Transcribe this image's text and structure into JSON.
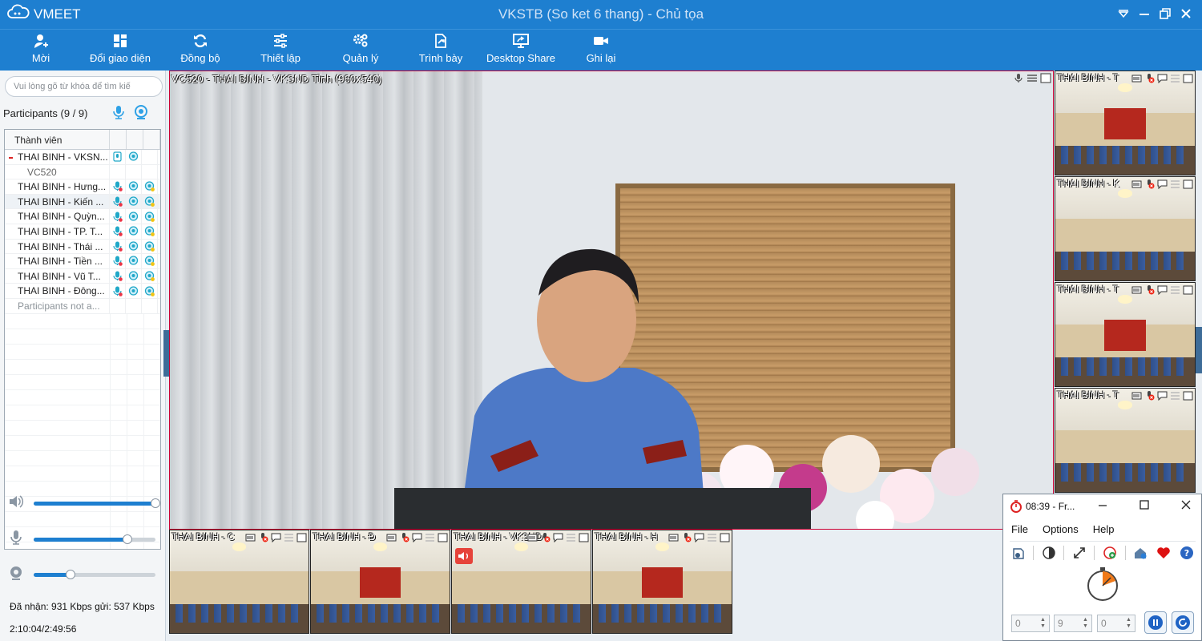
{
  "app": {
    "brand": "VMEET",
    "window_title": "VKSTB (So ket 6 thang) - Chủ tọa"
  },
  "toolbar": [
    {
      "label": "Mời",
      "icon": "invite-user-icon"
    },
    {
      "label": "Đổi giao diện",
      "icon": "layout-icon"
    },
    {
      "label": "Đồng bộ",
      "icon": "sync-icon"
    },
    {
      "label": "Thiết lập",
      "icon": "settings-sliders-icon"
    },
    {
      "label": "Quản lý",
      "icon": "manage-gears-icon"
    },
    {
      "label": "Trình bày",
      "icon": "present-icon"
    },
    {
      "label": "Desktop Share",
      "icon": "desktop-share-icon"
    },
    {
      "label": "Ghi lại",
      "icon": "record-camera-icon"
    }
  ],
  "sidebar": {
    "search_placeholder": "Vui lòng gõ từ khóa để tìm kiế",
    "participants_label": "Participants (9 / 9)",
    "column_header": "Thành viên",
    "participants": [
      {
        "name": "THAI BINH - VKSN...",
        "kind": "host"
      },
      {
        "name": "VC520",
        "kind": "sub"
      },
      {
        "name": "THAI BINH - Hưng...",
        "kind": "normal"
      },
      {
        "name": "THAI BINH - Kiến ...",
        "kind": "selected"
      },
      {
        "name": "THAI BINH - Quỳn...",
        "kind": "normal"
      },
      {
        "name": "THAI BINH - TP. T...",
        "kind": "normal"
      },
      {
        "name": "THAI BINH - Thái ...",
        "kind": "normal"
      },
      {
        "name": "THAI BINH - Tiền ...",
        "kind": "normal"
      },
      {
        "name": "THAI BINH - Vũ T...",
        "kind": "normal"
      },
      {
        "name": "THAI BINH - Đông...",
        "kind": "normal"
      },
      {
        "name": "Participants not a...",
        "kind": "muted"
      }
    ],
    "speaker_volume": 1.0,
    "mic_volume": 0.77,
    "camera_level": 0.3,
    "stats": "Đã nhận: 931 Kbps gửi: 537 Kbps",
    "time": "2:10:04/2:49:56"
  },
  "main_video": {
    "label": "VC520 - THAI BINH - VKSND Tỉnh (960x540)"
  },
  "side_thumbs": [
    {
      "label": "THAI BINH - T"
    },
    {
      "label": "THAI BINH - K"
    },
    {
      "label": "THAI BINH - T"
    },
    {
      "label": "THAI BINH - T"
    }
  ],
  "bottom_thumbs": [
    {
      "label": "THAI BINH - C"
    },
    {
      "label": "THAI BINH - Đ"
    },
    {
      "label": "THAI BINH - VKSND"
    },
    {
      "label": "THAI BINH - H"
    }
  ],
  "timer_window": {
    "title": "08:39 - Fr...",
    "menu": [
      "File",
      "Options",
      "Help"
    ],
    "spin_values": [
      "0",
      "9",
      "0"
    ]
  },
  "colors": {
    "titlebar": "#1e7fd0",
    "active_border": "#cc0033",
    "accent": "#1e7fd0"
  }
}
